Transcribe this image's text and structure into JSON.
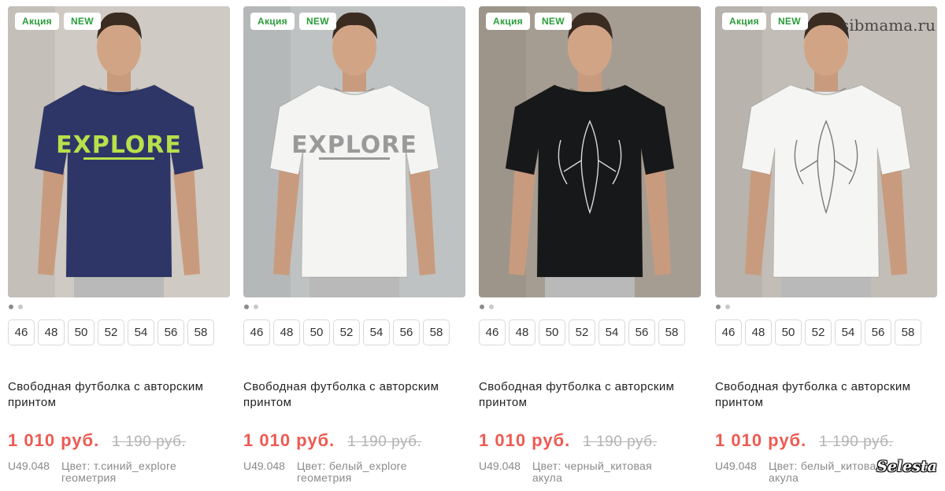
{
  "watermarks": {
    "site": "sibmama.ru",
    "logo": "Selesta"
  },
  "products": [
    {
      "badges": [
        "Акция",
        "NEW"
      ],
      "image": {
        "shirt_color": "#2e3668",
        "print_text": "EXPLORE",
        "print_color": "#b8e04a",
        "bg_color": "#cfcac3",
        "print_kind": "text"
      },
      "dots": 2,
      "sizes": [
        "46",
        "48",
        "50",
        "52",
        "54",
        "56",
        "58"
      ],
      "title": "Свободная футболка с авторским принтом",
      "price_new": "1 010 руб.",
      "price_old": "1 190 руб.",
      "sku": "U49.048",
      "color": "Цвет: т.синий_explore геометрия"
    },
    {
      "badges": [
        "Акция",
        "NEW"
      ],
      "image": {
        "shirt_color": "#f4f4f2",
        "print_text": "EXPLORE",
        "print_color": "#9a9a9a",
        "bg_color": "#bfc2c2",
        "print_kind": "text"
      },
      "dots": 2,
      "sizes": [
        "46",
        "48",
        "50",
        "52",
        "54",
        "56",
        "58"
      ],
      "title": "Свободная футболка с авторским принтом",
      "price_new": "1 010 руб.",
      "price_old": "1 190 руб.",
      "sku": "U49.048",
      "color": "Цвет: белый_explore геометрия"
    },
    {
      "badges": [
        "Акция",
        "NEW"
      ],
      "image": {
        "shirt_color": "#17181a",
        "print_text": "",
        "print_color": "#d9d9d9",
        "bg_color": "#a69d92",
        "print_kind": "shark"
      },
      "dots": 2,
      "sizes": [
        "46",
        "48",
        "50",
        "52",
        "54",
        "56",
        "58"
      ],
      "title": "Свободная футболка с авторским принтом",
      "price_new": "1 010 руб.",
      "price_old": "1 190 руб.",
      "sku": "U49.048",
      "color": "Цвет: черный_китовая акула"
    },
    {
      "badges": [
        "Акция",
        "NEW"
      ],
      "image": {
        "shirt_color": "#f5f5f3",
        "print_text": "",
        "print_color": "#7a7a7a",
        "bg_color": "#c2bdb6",
        "print_kind": "shark"
      },
      "dots": 2,
      "sizes": [
        "46",
        "48",
        "50",
        "52",
        "54",
        "56",
        "58"
      ],
      "title": "Свободная футболка с авторским принтом",
      "price_new": "1 010 руб.",
      "price_old": "1 190 руб.",
      "sku": "U49.048",
      "color": "Цвет: белый_китовая акула"
    }
  ]
}
